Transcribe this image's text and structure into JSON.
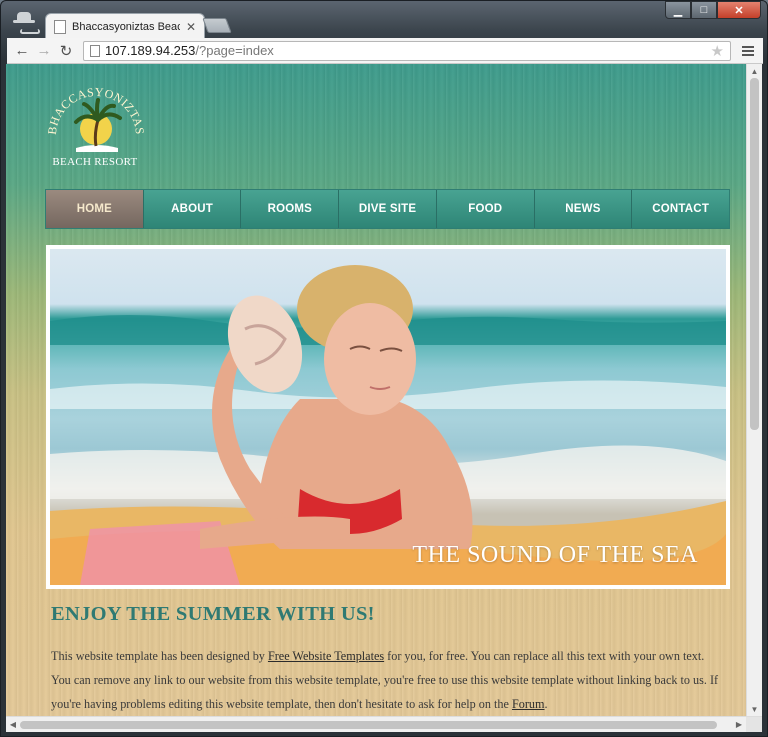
{
  "browser": {
    "tab_title": "Bhaccasyoniztas Beach Re",
    "url_host": "107.189.94.253",
    "url_path": "/?page=index",
    "icons": [
      "incognito-icon",
      "back-arrow-icon",
      "forward-arrow-icon",
      "reload-icon",
      "page-icon",
      "bookmark-star-icon",
      "menu-icon"
    ]
  },
  "site": {
    "logo_arc_text": "BHACCASYONIZTAS",
    "logo_subtitle": "BEACH RESORT",
    "nav": [
      "HOME",
      "ABOUT",
      "ROOMS",
      "DIVE SITE",
      "FOOD",
      "NEWS",
      "CONTACT"
    ],
    "active_nav": "HOME",
    "hero_caption": "THE SOUND OF THE SEA",
    "heading": "ENJOY THE SUMMER WITH US!",
    "paragraph": {
      "part1": "This website template has been designed by ",
      "link1": "Free Website Templates",
      "part2": " for you, for free. You can replace all this text with your own text. You can remove any link to our website from this website template, you're free to use this website template without linking back to us. If you're having problems editing this website template, then don't hesitate to ask for help on the ",
      "link2": "Forum",
      "part3": "."
    }
  },
  "colors": {
    "nav_bg": "#3a9584",
    "nav_active_bg": "#8a7b70",
    "heading": "#2f7a73",
    "caption": "#ffffff"
  }
}
